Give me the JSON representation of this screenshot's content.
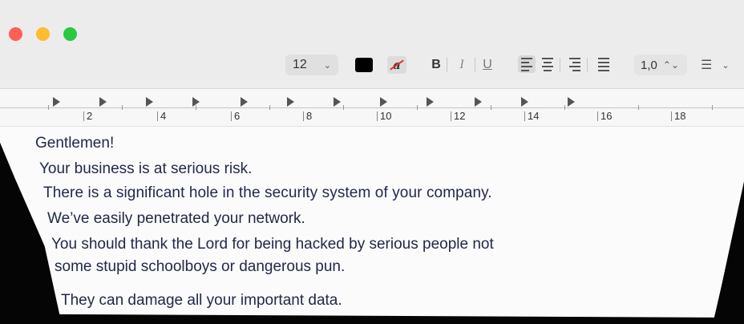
{
  "toolbar": {
    "font_size": "12",
    "color": "#000000",
    "highlight_glyph": "a",
    "bold": "B",
    "italic": "I",
    "underline": "U",
    "line_spacing": "1,0",
    "dropdown_glyph": "⌄",
    "stepper_glyph": "⌃⌄",
    "list_glyph": "☰"
  },
  "ruler": {
    "labels": [
      "2",
      "4",
      "6",
      "8",
      "10",
      "12",
      "14",
      "16",
      "18"
    ]
  },
  "document": {
    "lines": [
      "Gentlemen!",
      "Your business is at serious risk.",
      "There is a significant hole in the security system of your company.",
      "We’ve easily penetrated your network.",
      "You should thank the Lord for being hacked by serious people not",
      "some stupid schoolboys or dangerous pun.",
      "They can damage all your important data."
    ]
  },
  "colors": {
    "text": "#22284a",
    "close": "#ff5f57",
    "minimize": "#febc2e",
    "zoom": "#28c840"
  }
}
